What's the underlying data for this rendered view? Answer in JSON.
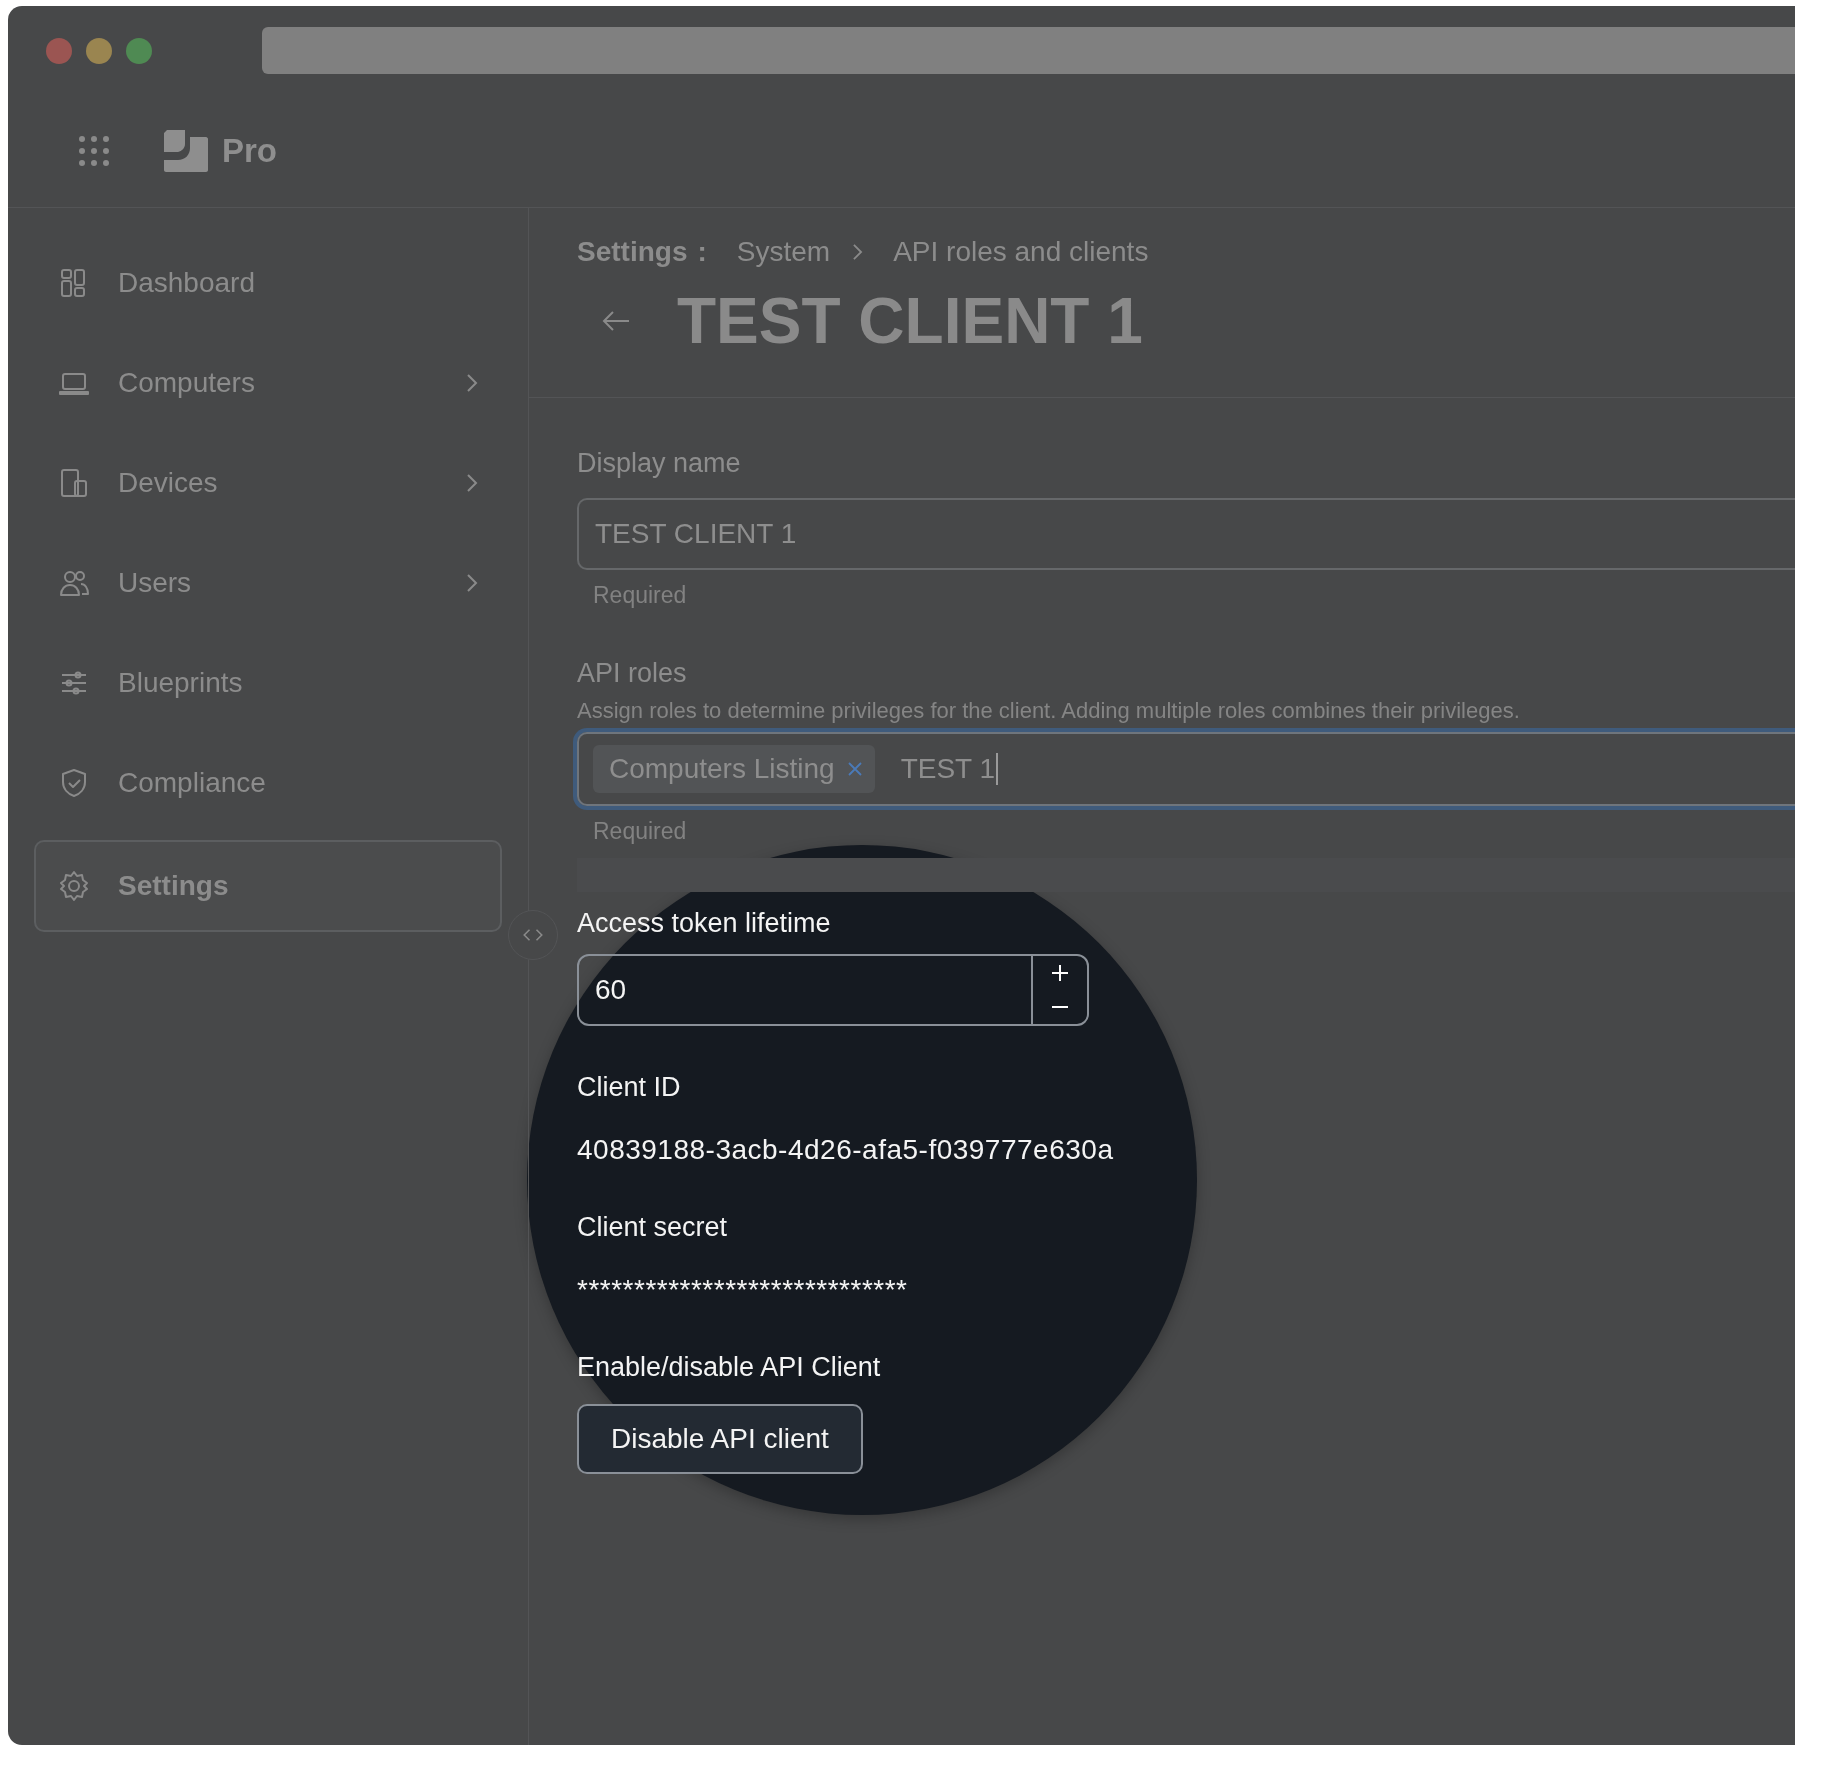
{
  "app": {
    "name": "Pro"
  },
  "sidebar": {
    "items": [
      {
        "label": "Dashboard",
        "has_submenu": false,
        "selected": false
      },
      {
        "label": "Computers",
        "has_submenu": true,
        "selected": false
      },
      {
        "label": "Devices",
        "has_submenu": true,
        "selected": false
      },
      {
        "label": "Users",
        "has_submenu": true,
        "selected": false
      },
      {
        "label": "Blueprints",
        "has_submenu": false,
        "selected": false
      },
      {
        "label": "Compliance",
        "has_submenu": false,
        "selected": false
      },
      {
        "label": "Settings",
        "has_submenu": false,
        "selected": true
      }
    ]
  },
  "breadcrumb": [
    {
      "label": "Settings",
      "separator_text": ":",
      "chevron": false,
      "bold": true
    },
    {
      "label": "System",
      "chevron": true,
      "bold": false
    },
    {
      "label": "API roles and clients",
      "chevron": false,
      "bold": false
    }
  ],
  "page_title": "TEST CLIENT 1",
  "display_name": {
    "label": "Display name",
    "value": "TEST CLIENT 1",
    "hint": "Required"
  },
  "api_roles": {
    "label": "API roles",
    "description": "Assign roles to determine privileges for the client. Adding multiple roles combines their privileges.",
    "tags": [
      {
        "label": "Computers Listing"
      }
    ],
    "value": "TEST 1",
    "focused": true,
    "hint": "Required"
  },
  "access_token_lifetime": {
    "label": "Access token lifetime",
    "value": "60"
  },
  "client_id": {
    "label": "Client ID",
    "value": "40839188-3acb-4d26-afa5-f039777e630a"
  },
  "client_secret": {
    "label": "Client secret",
    "value": "*****************************"
  },
  "enable_client": {
    "label": "Enable/disable API Client",
    "button": "Disable API client"
  }
}
